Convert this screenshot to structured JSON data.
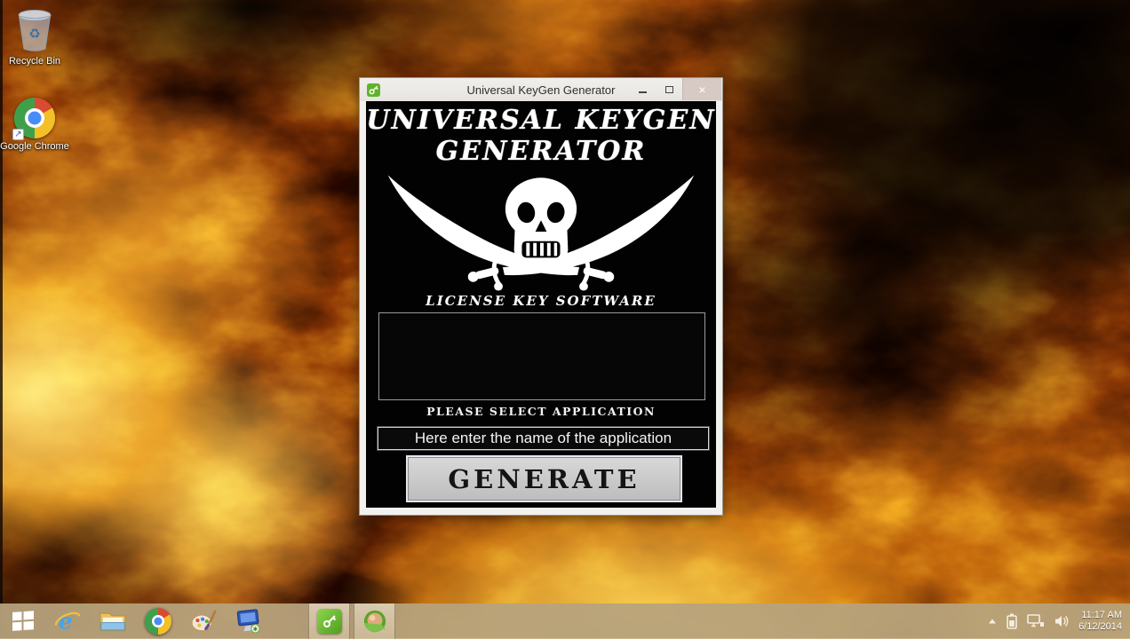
{
  "desktop": {
    "icons": [
      {
        "name": "recycle-bin",
        "label": "Recycle Bin"
      },
      {
        "name": "google-chrome-shortcut",
        "label": "Google Chrome"
      }
    ]
  },
  "keygen_window": {
    "title": "Universal KeyGen Generator",
    "close_glyph": "×",
    "heading": {
      "line1": "UNIVERSAL KEYGEN",
      "line2": "GENERATOR"
    },
    "logo": {
      "icon": "pirate-skull-crossed-swords-icon",
      "caption": "LICENSE KEY SOFTWARE"
    },
    "key_list": {
      "value": ""
    },
    "select_label": "PLEASE SELECT APPLICATION",
    "app_input": {
      "value": "Here enter the name of the application"
    },
    "generate_button": "GENERATE"
  },
  "taskbar": {
    "start_icon": "windows-start-icon",
    "pinned_icons": [
      "internet-explorer-icon",
      "file-explorer-icon",
      "google-chrome-icon",
      "paint-icon",
      "computer-icon",
      "keygen-app-icon",
      "download-manager-icon"
    ],
    "active_buttons": [
      "keygen-app",
      "download-manager"
    ],
    "tray": {
      "icons": [
        "hidden-icons-arrow-icon",
        "battery-icon",
        "network-icon",
        "volume-icon"
      ],
      "time": "11:17 AM",
      "date": "6/12/2014"
    }
  },
  "colors": {
    "taskbar_tan": "#b7a37c",
    "titlebar_gray": "#ece9e5",
    "client_black": "#020202",
    "button_face": "#c9c9c9",
    "fire_bright": "#f7c94f",
    "fire_mid": "#e08018",
    "app_green": "#6abf3a"
  }
}
